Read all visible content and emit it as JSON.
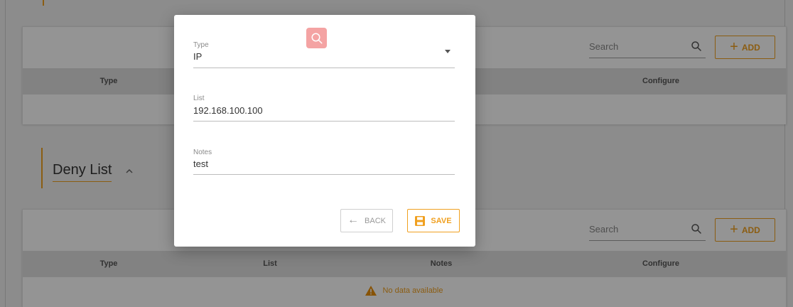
{
  "allow_section": {
    "search_label": "Search",
    "add_label": "ADD",
    "columns": [
      "Type",
      "Configure"
    ]
  },
  "deny_section": {
    "title": "Deny List",
    "search_label": "Search",
    "add_label": "ADD",
    "columns": [
      "Type",
      "List",
      "Notes",
      "Configure"
    ],
    "empty_message": "No data available"
  },
  "dialog": {
    "badge_icon": "search-icon",
    "fields": {
      "type": {
        "label": "Type",
        "value": "IP"
      },
      "list": {
        "label": "List",
        "value": "192.168.100.100"
      },
      "notes": {
        "label": "Notes",
        "value": "test"
      }
    },
    "back_label": "BACK",
    "save_label": "SAVE"
  },
  "colors": {
    "accent": "#f0a020",
    "badge": "#f4a3a3",
    "table_header": "#e0e0e0",
    "overlay": "rgba(0,0,0,0.42)"
  }
}
